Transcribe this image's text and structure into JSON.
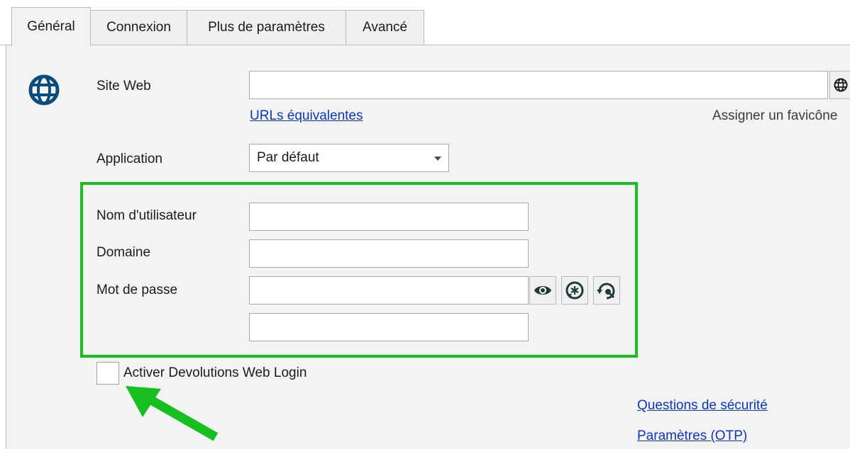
{
  "tabs": [
    {
      "label": "Général",
      "active": true
    },
    {
      "label": "Connexion",
      "active": false
    },
    {
      "label": "Plus de paramètres",
      "active": false
    },
    {
      "label": "Avancé",
      "active": false
    }
  ],
  "general": {
    "entry_icon": "globe-icon",
    "website": {
      "label": "Site Web",
      "value": "",
      "button_icon": "globe-icon"
    },
    "equivalent_urls_link": "URLs équivalentes",
    "assign_favicon_label": "Assigner un favicône",
    "application": {
      "label": "Application",
      "value": "Par défaut"
    },
    "credentials": {
      "username_label": "Nom d'utilisateur",
      "username_value": "",
      "domain_label": "Domaine",
      "domain_value": "",
      "password_label": "Mot de passe",
      "password_value": "",
      "password_buttons": [
        "eye-icon",
        "password-generator-icon",
        "password-history-icon"
      ],
      "extra_value": ""
    },
    "web_login_checkbox": {
      "label": "Activer Devolutions Web Login",
      "checked": false
    },
    "security_questions_link": "Questions de sécurité",
    "otp_settings_link": "Paramètres (OTP)"
  },
  "annotations": {
    "highlight_color": "#17c020"
  },
  "colors": {
    "icon": "#0b4c7d",
    "link": "#0a37c8"
  }
}
